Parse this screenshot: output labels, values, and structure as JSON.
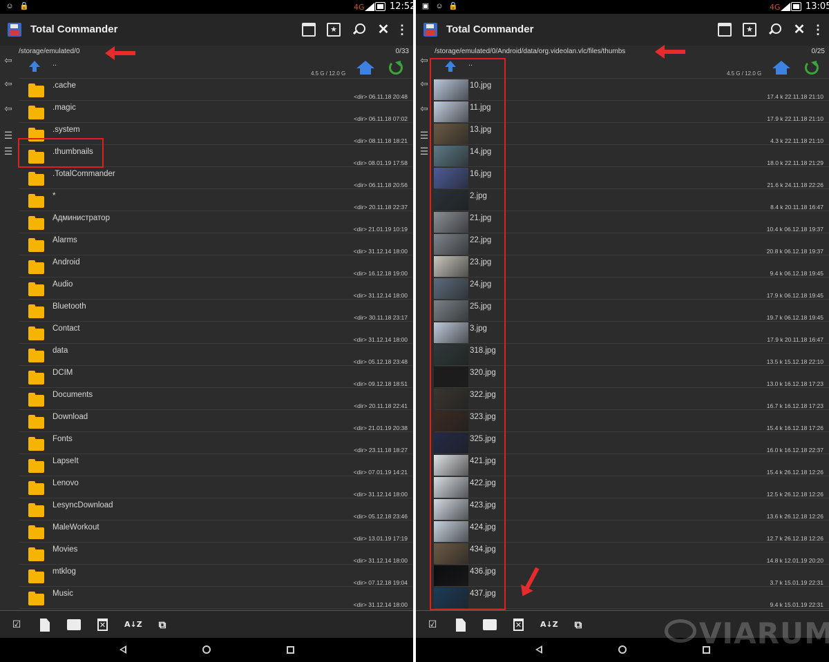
{
  "app": {
    "title": "Total Commander"
  },
  "left": {
    "status": {
      "network": "4G",
      "time": "12:52"
    },
    "path": "/storage/emulated/0",
    "count": "0/33",
    "disk": "4.5 G / 12.0 G",
    "up_label": "..",
    "rows": [
      {
        "name": ".cache",
        "meta": "<dir> 06.11.18 20:48"
      },
      {
        "name": ".magic",
        "meta": "<dir> 06.11.18 07:02"
      },
      {
        "name": ".system",
        "meta": "<dir> 08.11.18 18:21"
      },
      {
        "name": ".thumbnails",
        "meta": "<dir> 08.01.19 17:58"
      },
      {
        "name": ".TotalCommander",
        "meta": "<dir> 06.11.18 20:56"
      },
      {
        "name": "*",
        "meta": "<dir> 20.11.18 22:37"
      },
      {
        "name": "Администратор",
        "meta": "<dir> 21.01.19 10:19"
      },
      {
        "name": "Alarms",
        "meta": "<dir> 31.12.14 18:00"
      },
      {
        "name": "Android",
        "meta": "<dir> 16.12.18 19:00"
      },
      {
        "name": "Audio",
        "meta": "<dir> 31.12.14 18:00"
      },
      {
        "name": "Bluetooth",
        "meta": "<dir> 30.11.18 23:17"
      },
      {
        "name": "Contact",
        "meta": "<dir> 31.12.14 18:00"
      },
      {
        "name": "data",
        "meta": "<dir> 05.12.18 23:48"
      },
      {
        "name": "DCIM",
        "meta": "<dir> 09.12.18 18:51"
      },
      {
        "name": "Documents",
        "meta": "<dir> 20.11.18 22:41"
      },
      {
        "name": "Download",
        "meta": "<dir> 21.01.19 20:38"
      },
      {
        "name": "Fonts",
        "meta": "<dir> 23.11.18 18:27"
      },
      {
        "name": "LapseIt",
        "meta": "<dir> 07.01.19 14:21"
      },
      {
        "name": "Lenovo",
        "meta": "<dir> 31.12.14 18:00"
      },
      {
        "name": "LesyncDownload",
        "meta": "<dir> 05.12.18 23:46"
      },
      {
        "name": "MaleWorkout",
        "meta": "<dir> 13.01.19 17:19"
      },
      {
        "name": "Movies",
        "meta": "<dir> 31.12.14 18:00"
      },
      {
        "name": "mtklog",
        "meta": "<dir> 07.12.18 19:04"
      },
      {
        "name": "Music",
        "meta": "<dir> 31.12.14 18:00"
      }
    ]
  },
  "right": {
    "status": {
      "network": "4G",
      "time": "13:05"
    },
    "path": "/storage/emulated/0/Android/data/org.videolan.vlc/files/thumbs",
    "count": "0/25",
    "disk": "4.5 G / 12.0 G",
    "up_label": "..",
    "rows": [
      {
        "name": "10.jpg",
        "meta": "17.4 k  22.11.18 21:10",
        "thumb": "#b9c7dc"
      },
      {
        "name": "11.jpg",
        "meta": "17.9 k  22.11.18 21:10",
        "thumb": "#c2cfe0"
      },
      {
        "name": "13.jpg",
        "meta": "4.3 k  22.11.18 21:10",
        "thumb": "#6a5a44"
      },
      {
        "name": "14.jpg",
        "meta": "18.0 k  22.11.18 21:29",
        "thumb": "#5d7a86"
      },
      {
        "name": "16.jpg",
        "meta": "21.6 k  24.11.18 22:26",
        "thumb": "#4d5c9a"
      },
      {
        "name": "2.jpg",
        "meta": "8.4 k  20.11.18 16:47",
        "thumb": "#283238"
      },
      {
        "name": "21.jpg",
        "meta": "10.4 k  06.12.18 19:37",
        "thumb": "#8a8f96"
      },
      {
        "name": "22.jpg",
        "meta": "20.8 k  06.12.18 19:37",
        "thumb": "#7d848c"
      },
      {
        "name": "23.jpg",
        "meta": "9.4 k  06.12.18 19:45",
        "thumb": "#c9c6bd"
      },
      {
        "name": "24.jpg",
        "meta": "17.9 k  06.12.18 19:45",
        "thumb": "#5c6c7c"
      },
      {
        "name": "25.jpg",
        "meta": "19.7 k  06.12.18 19:45",
        "thumb": "#7a8288"
      },
      {
        "name": "3.jpg",
        "meta": "17.9 k  20.11.18 16:47",
        "thumb": "#bfcadb"
      },
      {
        "name": "318.jpg",
        "meta": "13.5 k  15.12.18 22:10",
        "thumb": "#2e3a3a"
      },
      {
        "name": "320.jpg",
        "meta": "13.0 k  16.12.18 17:23",
        "thumb": "#1c1c1c"
      },
      {
        "name": "322.jpg",
        "meta": "16.7 k  16.12.18 17:23",
        "thumb": "#3a3630"
      },
      {
        "name": "323.jpg",
        "meta": "15.4 k  16.12.18 17:26",
        "thumb": "#3c2a22"
      },
      {
        "name": "325.jpg",
        "meta": "16.0 k  16.12.18 22:37",
        "thumb": "#242a48"
      },
      {
        "name": "421.jpg",
        "meta": "15.4 k  26.12.18 12:26",
        "thumb": "#dfe3e6"
      },
      {
        "name": "422.jpg",
        "meta": "12.5 k  26.12.18 12:26",
        "thumb": "#d7dde4"
      },
      {
        "name": "423.jpg",
        "meta": "13.6 k  26.12.18 12:26",
        "thumb": "#d2dae3"
      },
      {
        "name": "424.jpg",
        "meta": "12.7 k  26.12.18 12:26",
        "thumb": "#c8d3df"
      },
      {
        "name": "434.jpg",
        "meta": "14.8 k  12.01.19 20:20",
        "thumb": "#6c5a44"
      },
      {
        "name": "436.jpg",
        "meta": "3.7 k  15.01.19 22:31",
        "thumb": "#0c0c10"
      },
      {
        "name": "437.jpg",
        "meta": "9.4 k  15.01.19 22:31",
        "thumb": "#1a3c5a"
      }
    ]
  },
  "toolbar": {
    "sort_label": "A↓Z"
  },
  "watermark": "VIARUM",
  "colors": {
    "accent_blue": "#3c82e3",
    "folder_yellow": "#f5b400",
    "annotation_red": "#e02020"
  }
}
